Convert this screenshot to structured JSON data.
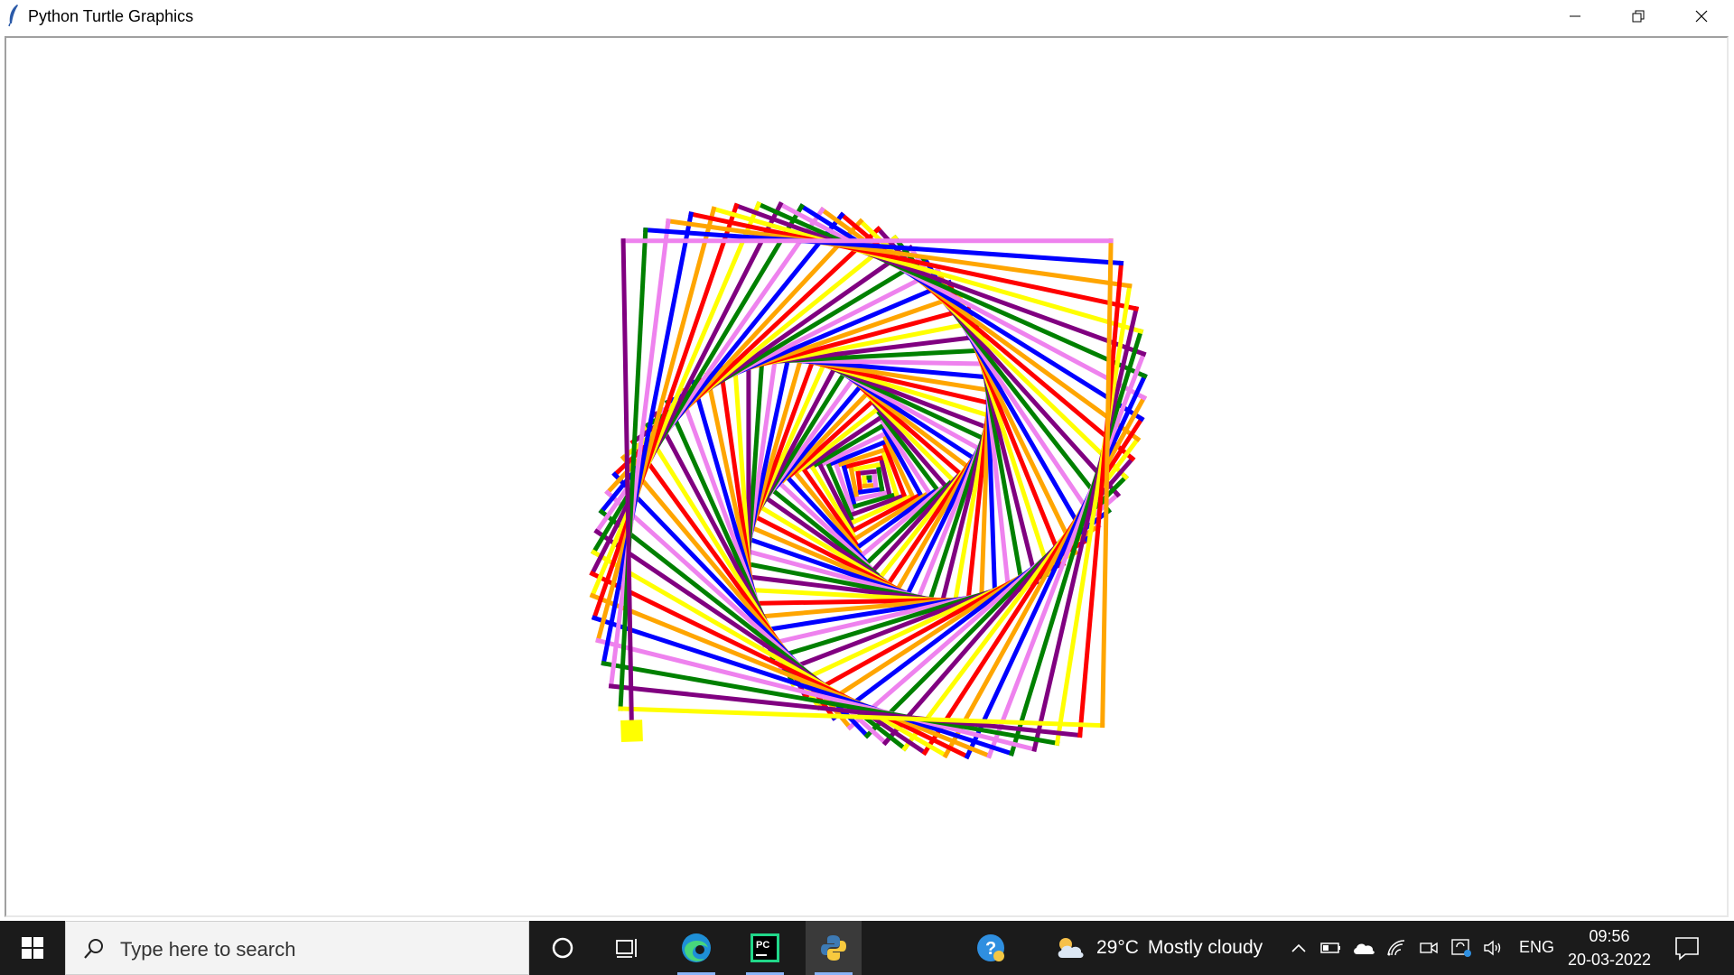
{
  "window": {
    "title": "Python Turtle Graphics",
    "controls": [
      "minimize",
      "restore",
      "close"
    ]
  },
  "canvas": {
    "drawing": "colored square spiral",
    "colors": [
      "#ff0000",
      "#0000ff",
      "#008000",
      "#ffff00",
      "#ffa500",
      "#ee82ee",
      "#800080"
    ],
    "turtle_color": "#ffff00"
  },
  "taskbar": {
    "search_placeholder": "Type here to search",
    "pinned": [
      "cortana-icon",
      "task-view-icon",
      "edge-icon",
      "pycharm-icon",
      "python-icon"
    ],
    "weather": {
      "temp": "29°C",
      "condition": "Mostly cloudy"
    },
    "tray": {
      "language": "ENG"
    },
    "clock": {
      "time": "09:56",
      "date": "20-03-2022"
    }
  }
}
